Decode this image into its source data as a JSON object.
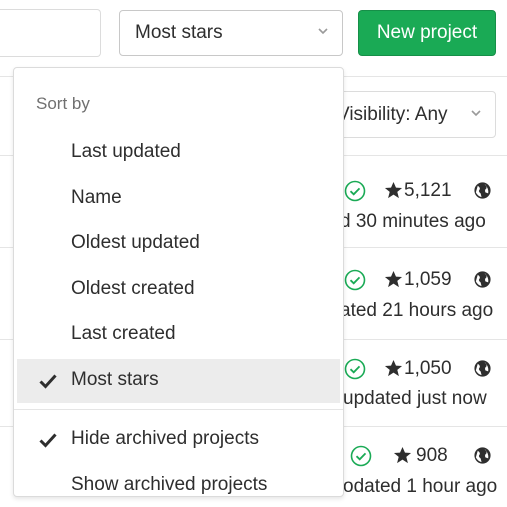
{
  "toolbar": {
    "sort_selected": "Most stars",
    "new_project_label": "New project"
  },
  "filters": {
    "visibility_label": "Visibility: Any"
  },
  "projects": [
    {
      "stars": "5,121",
      "time": "d 30 minutes ago"
    },
    {
      "stars": "1,059",
      "time": "ated 21 hours ago"
    },
    {
      "stars": "1,050",
      "time": "updated just now"
    },
    {
      "stars": "908",
      "time": "odated 1 hour ago"
    }
  ],
  "sort_dropdown": {
    "header": "Sort by",
    "items": [
      {
        "label": "Last updated"
      },
      {
        "label": "Name"
      },
      {
        "label": "Oldest updated"
      },
      {
        "label": "Oldest created"
      },
      {
        "label": "Last created"
      },
      {
        "label": "Most stars"
      }
    ],
    "archive_items": [
      {
        "label": "Hide archived projects"
      },
      {
        "label": "Show archived projects"
      }
    ]
  },
  "colors": {
    "primary_green": "#1aaa55",
    "pipeline_success": "#1aaa55",
    "active_row_bg": "#ececec"
  }
}
